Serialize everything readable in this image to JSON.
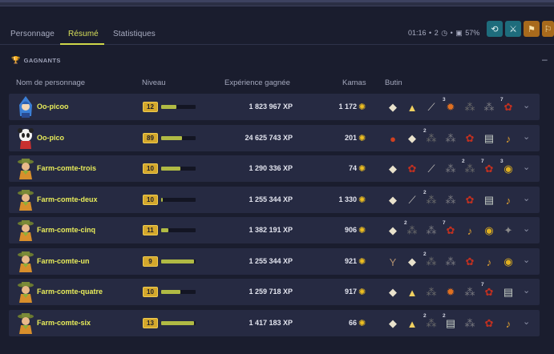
{
  "tabs": [
    "Personnage",
    "Résumé",
    "Statistiques"
  ],
  "status": {
    "time": "01:16",
    "turns": "2",
    "pct": "57%"
  },
  "section": {
    "title": "GAGNANTS"
  },
  "columns": {
    "name": "Nom de personnage",
    "level": "Niveau",
    "xp": "Expérience gagnée",
    "kamas": "Kamas",
    "loot": "Butin"
  },
  "players": [
    {
      "name": "Oo-picoo",
      "level": "12",
      "progress": 0.45,
      "xp": "1 823 967 XP",
      "kamas": "1 172",
      "avatar": "blue-hood",
      "loot": [
        [
          "",
          "#e9e2cc",
          "◆"
        ],
        [
          "",
          "#f0d060",
          "▲"
        ],
        [
          "",
          "#c9c6c0",
          "⟋"
        ],
        [
          "3",
          "#e07020",
          "✹"
        ],
        [
          "",
          "#6a6a6a",
          "⁂"
        ],
        [
          "",
          "#7a7a80",
          "⁂"
        ],
        [
          "7",
          "#c03020",
          "✿"
        ]
      ]
    },
    {
      "name": "Oo-pico",
      "level": "89",
      "progress": 0.6,
      "xp": "24 625 743 XP",
      "kamas": "201",
      "avatar": "panda",
      "loot": [
        [
          "",
          "#d04020",
          "●"
        ],
        [
          "",
          "#e9e2cc",
          "◆"
        ],
        [
          "2",
          "#6a6a6a",
          "⁂"
        ],
        [
          "",
          "#7a7a80",
          "⁂"
        ],
        [
          "",
          "#c03020",
          "✿"
        ],
        [
          "",
          "#c8d0c8",
          "▤"
        ],
        [
          "",
          "#e0a030",
          "♪"
        ]
      ]
    },
    {
      "name": "Farm-comte-trois",
      "level": "10",
      "progress": 0.55,
      "xp": "1 290 336 XP",
      "kamas": "74",
      "avatar": "farmer",
      "loot": [
        [
          "",
          "#e9e2cc",
          "◆"
        ],
        [
          "",
          "#c03020",
          "✿"
        ],
        [
          "",
          "#c9c6c0",
          "⟋"
        ],
        [
          "",
          "#7a7a80",
          "⁂"
        ],
        [
          "2",
          "#6a6a6a",
          "⁂"
        ],
        [
          "7",
          "#c03020",
          "✿"
        ],
        [
          "3",
          "#e0b020",
          "◉"
        ]
      ]
    },
    {
      "name": "Farm-comte-deux",
      "level": "10",
      "progress": 0.05,
      "xp": "1 255 344 XP",
      "kamas": "1 330",
      "avatar": "farmer",
      "loot": [
        [
          "",
          "#e9e2cc",
          "◆"
        ],
        [
          "",
          "#c9c6c0",
          "⟋"
        ],
        [
          "2",
          "#6a6a6a",
          "⁂"
        ],
        [
          "",
          "#7a7a80",
          "⁂"
        ],
        [
          "",
          "#c03020",
          "✿"
        ],
        [
          "",
          "#c8d0c8",
          "▤"
        ],
        [
          "",
          "#e0a030",
          "♪"
        ]
      ]
    },
    {
      "name": "Farm-comte-cinq",
      "level": "11",
      "progress": 0.2,
      "xp": "1 382 191 XP",
      "kamas": "906",
      "avatar": "farmer",
      "loot": [
        [
          "",
          "#e9e2cc",
          "◆"
        ],
        [
          "2",
          "#6a6a6a",
          "⁂"
        ],
        [
          "",
          "#7a7a80",
          "⁂"
        ],
        [
          "7",
          "#c03020",
          "✿"
        ],
        [
          "",
          "#e0a030",
          "♪"
        ],
        [
          "",
          "#e0b020",
          "◉"
        ],
        [
          "",
          "#8a8a8a",
          "✦"
        ]
      ]
    },
    {
      "name": "Farm-comte-un",
      "level": "9",
      "progress": 0.95,
      "xp": "1 255 344 XP",
      "kamas": "921",
      "avatar": "farmer",
      "loot": [
        [
          "",
          "#b09070",
          "Y"
        ],
        [
          "",
          "#e9e2cc",
          "◆"
        ],
        [
          "2",
          "#6a6a6a",
          "⁂"
        ],
        [
          "",
          "#7a7a80",
          "⁂"
        ],
        [
          "",
          "#c03020",
          "✿"
        ],
        [
          "",
          "#e0a030",
          "♪"
        ],
        [
          "",
          "#e0b020",
          "◉"
        ]
      ]
    },
    {
      "name": "Farm-comte-quatre",
      "level": "10",
      "progress": 0.55,
      "xp": "1 259 718 XP",
      "kamas": "917",
      "avatar": "farmer",
      "loot": [
        [
          "",
          "#e9e2cc",
          "◆"
        ],
        [
          "",
          "#f0d060",
          "▲"
        ],
        [
          "",
          "#6a6a6a",
          "⁂"
        ],
        [
          "",
          "#e07020",
          "✹"
        ],
        [
          "",
          "#7a7a80",
          "⁂"
        ],
        [
          "7",
          "#c03020",
          "✿"
        ],
        [
          "",
          "#c8d0c8",
          "▤"
        ]
      ]
    },
    {
      "name": "Farm-comte-six",
      "level": "13",
      "progress": 0.95,
      "xp": "1 417 183 XP",
      "kamas": "66",
      "avatar": "farmer",
      "loot": [
        [
          "",
          "#e9e2cc",
          "◆"
        ],
        [
          "",
          "#f0d060",
          "▲"
        ],
        [
          "2",
          "#6a6a6a",
          "⁂"
        ],
        [
          "2",
          "#c8d0c8",
          "▤"
        ],
        [
          "",
          "#7a7a80",
          "⁂"
        ],
        [
          "",
          "#c03020",
          "✿"
        ],
        [
          "",
          "#e0a030",
          "♪"
        ]
      ]
    }
  ]
}
